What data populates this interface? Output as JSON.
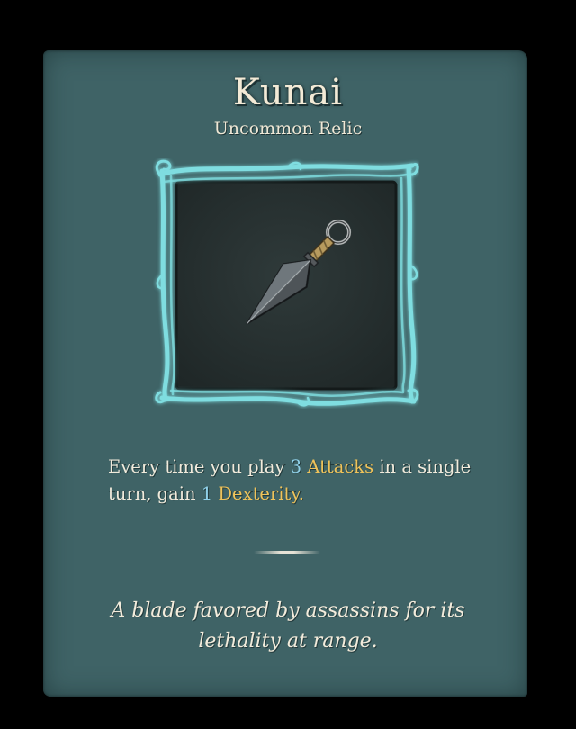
{
  "relic": {
    "name": "Kunai",
    "rarity": "Uncommon Relic",
    "icon": "kunai-icon",
    "description": {
      "part1": "Every time you play ",
      "count1": "3",
      "keyword1": "Attacks",
      "part2": " in a single turn, gain ",
      "count2": "1",
      "keyword2": "Dexterity."
    },
    "flavor": "A blade favored by assassins for its lethality at range."
  },
  "colors": {
    "panel": "#3f6366",
    "frame_glow": "#7fdde0",
    "number": "#8fd0e8",
    "keyword": "#efc35a",
    "text": "#f1ebdc"
  }
}
